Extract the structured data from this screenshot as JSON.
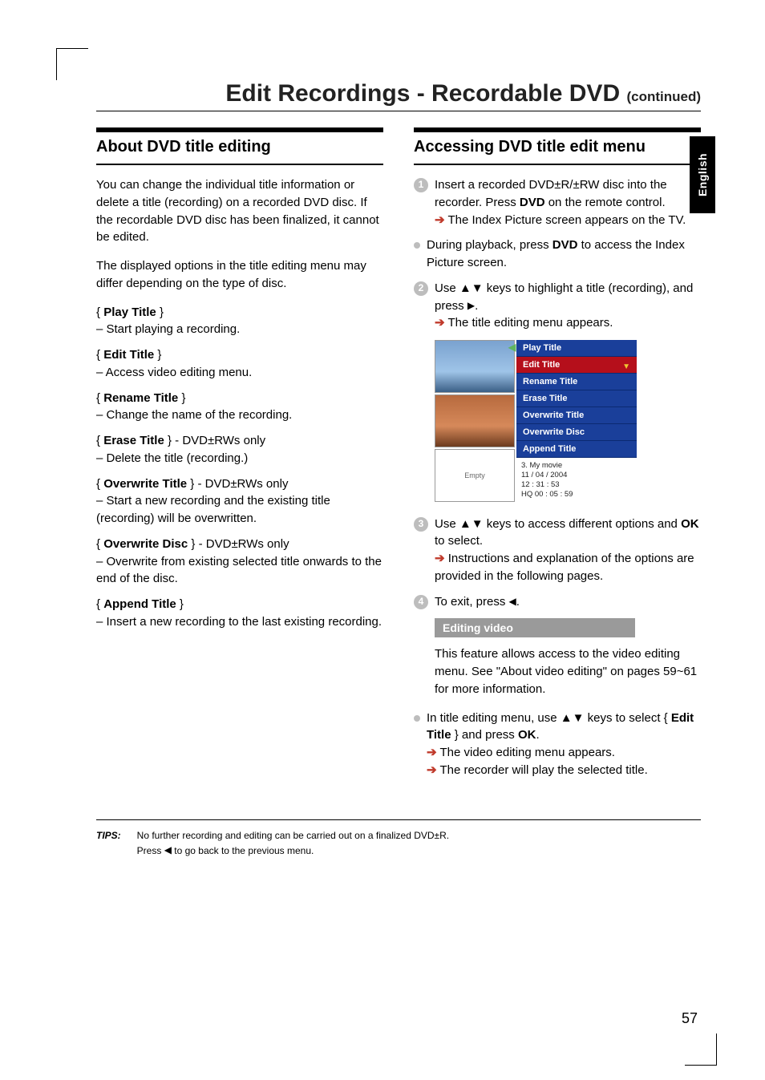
{
  "header": {
    "title_main": "Edit Recordings - Recordable DVD",
    "title_cont": "(continued)"
  },
  "side_tab": "English",
  "left": {
    "heading": "About DVD title editing",
    "intro1": "You can change the individual title information or delete a title (recording) on a recorded DVD disc. If the recordable DVD disc has been finalized, it cannot be edited.",
    "intro2": "The displayed options in the title editing menu may differ depending on the type of disc.",
    "opts": [
      {
        "name": "Play Title",
        "suffix": "",
        "desc": "– Start playing a recording."
      },
      {
        "name": "Edit Title",
        "suffix": "",
        "desc": "– Access video editing menu."
      },
      {
        "name": "Rename Title",
        "suffix": "",
        "desc": "– Change the name of the recording."
      },
      {
        "name": "Erase Title",
        "suffix": " - DVD±RWs only",
        "desc": "– Delete the title (recording.)"
      },
      {
        "name": "Overwrite Title",
        "suffix": " - DVD±RWs only",
        "desc": "– Start a new recording and the existing title (recording) will be overwritten."
      },
      {
        "name": "Overwrite Disc",
        "suffix": " - DVD±RWs only",
        "desc": "– Overwrite from existing selected title onwards to the end of the disc."
      },
      {
        "name": "Append Title",
        "suffix": "",
        "desc": "– Insert a new recording to the last existing recording."
      }
    ]
  },
  "right": {
    "heading": "Accessing DVD title edit menu",
    "step1_a": "Insert a recorded DVD±R/±RW disc into the recorder. Press ",
    "step1_b": "DVD",
    "step1_c": " on the remote control.",
    "step1_res": "The Index Picture screen appears on the TV.",
    "bullet1_a": "During playback, press ",
    "bullet1_b": "DVD",
    "bullet1_c": " to access the Index Picture screen.",
    "step2_a": "Use ▲▼ keys to highlight a title (recording), and press ",
    "step2_b": ".",
    "step2_res": "The title editing menu appears.",
    "menu_items": [
      "Play Title",
      "Edit Title",
      "Rename Title",
      "Erase Title",
      "Overwrite Title",
      "Overwrite Disc",
      "Append Title"
    ],
    "thumb_empty": "Empty",
    "menu_meta_lines": [
      "3. My movie",
      "11 / 04 / 2004",
      "12 : 31 : 53",
      "HQ 00 : 05 : 59"
    ],
    "step3_a": "Use ▲▼ keys to access different options and ",
    "step3_b": "OK",
    "step3_c": " to select.",
    "step3_res": "Instructions and explanation of the options are provided in the following pages.",
    "step4_a": "To exit, press ",
    "step4_b": ".",
    "sub_heading": "Editing video",
    "sub_body": "This feature allows access to the video editing menu. See \"About video editing\" on pages 59~61 for more information.",
    "sub_bullet_a": "In title editing menu, use ▲▼ keys to select { ",
    "sub_bullet_b": "Edit Title",
    "sub_bullet_c": " } and press ",
    "sub_bullet_d": "OK",
    "sub_bullet_e": ".",
    "sub_res1": "The video editing menu appears.",
    "sub_res2": "The recorder will play the selected title."
  },
  "tips": {
    "label": "TIPS:",
    "line1": "No further recording and editing can be carried out on a finalized DVD±R.",
    "line2_a": "Press ",
    "line2_b": " to go back to the previous menu."
  },
  "page_number": "57"
}
